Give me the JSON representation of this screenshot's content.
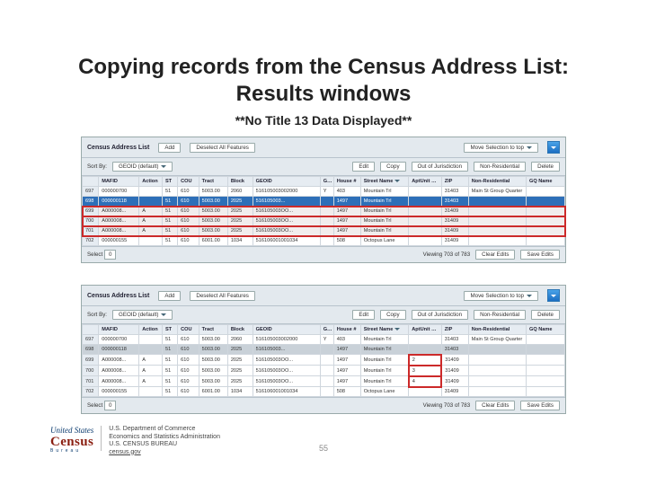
{
  "title": "Copying records from the Census Address List: Results windows",
  "subtitle": "**No Title 13 Data Displayed**",
  "page_number": "55",
  "panel": {
    "header_title": "Census Address List",
    "add": "Add",
    "deselect": "Deselect All Features",
    "move_top": "Move Selection to top",
    "sort_by_label": "Sort By:",
    "sort_by_value": "GEOID (default)",
    "edit": "Edit",
    "copy": "Copy",
    "out_of_jur": "Out of Jurisdiction",
    "non_res": "Non-Residential",
    "delete": "Delete",
    "select_label": "Select",
    "select_count": "0",
    "viewing": "Viewing 703 of 783",
    "clear_edits": "Clear Edits",
    "save_edits": "Save Edits"
  },
  "columns": [
    "MAFID",
    "Action",
    "ST",
    "COU",
    "Tract",
    "Block",
    "GEOID",
    "GQ",
    "House #",
    "Street Name",
    "AptUnit #",
    "ZIP",
    "Non-Residential",
    "GQ Name"
  ],
  "panel1_rows": [
    {
      "idx": "697",
      "mafid": "000000700",
      "act": "",
      "st": "51",
      "cou": "610",
      "tract": "5003.00",
      "block": "2060",
      "geoid": "516105003002000",
      "gq": "Y",
      "house": "403",
      "street": "Mountain Trl",
      "apt": "",
      "zip": "31403",
      "nonres": "Main St Group Quarter",
      "gqname": "",
      "cls": "row-norm"
    },
    {
      "idx": "698",
      "mafid": "000000118",
      "act": "",
      "st": "51",
      "cou": "610",
      "tract": "5003.00",
      "block": "2025",
      "geoid": "516105003...",
      "gq": "",
      "house": "1497",
      "street": "Mountain Trl",
      "apt": "",
      "zip": "31403",
      "nonres": "",
      "gqname": "",
      "cls": "sel-blue"
    },
    {
      "idx": "699",
      "mafid": "A000008...",
      "act": "A",
      "st": "51",
      "cou": "610",
      "tract": "5003.00",
      "block": "2025",
      "geoid": "516105003OO...",
      "gq": "",
      "house": "1497",
      "street": "Mountain Trl",
      "apt": "",
      "zip": "31409",
      "nonres": "",
      "gqname": "",
      "cls": "hl-red"
    },
    {
      "idx": "700",
      "mafid": "A000008...",
      "act": "A",
      "st": "51",
      "cou": "610",
      "tract": "5003.00",
      "block": "2025",
      "geoid": "516105003OO...",
      "gq": "",
      "house": "1497",
      "street": "Mountain Trl",
      "apt": "",
      "zip": "31409",
      "nonres": "",
      "gqname": "",
      "cls": "hl-red"
    },
    {
      "idx": "701",
      "mafid": "A000008...",
      "act": "A",
      "st": "51",
      "cou": "610",
      "tract": "5003.00",
      "block": "2025",
      "geoid": "516105003OO...",
      "gq": "",
      "house": "1497",
      "street": "Mountain Trl",
      "apt": "",
      "zip": "31409",
      "nonres": "",
      "gqname": "",
      "cls": "hl-red"
    },
    {
      "idx": "702",
      "mafid": "000000155",
      "act": "",
      "st": "51",
      "cou": "610",
      "tract": "6001.00",
      "block": "1034",
      "geoid": "516106001001034",
      "gq": "",
      "house": "508",
      "street": "Octopus Lane",
      "apt": "",
      "zip": "31409",
      "nonres": "",
      "gqname": "",
      "cls": "row-norm"
    }
  ],
  "panel2_rows": [
    {
      "idx": "697",
      "mafid": "000000700",
      "act": "",
      "st": "51",
      "cou": "610",
      "tract": "5003.00",
      "block": "2060",
      "geoid": "516105003002000",
      "gq": "Y",
      "house": "403",
      "street": "Mountain Trl",
      "apt": "",
      "zip": "31403",
      "nonres": "Main St Group Quarter",
      "gqname": "",
      "cls": "row-norm",
      "aptcls": ""
    },
    {
      "idx": "698",
      "mafid": "000000118",
      "act": "",
      "st": "51",
      "cou": "610",
      "tract": "5003.00",
      "block": "2025",
      "geoid": "516105003...",
      "gq": "",
      "house": "1497",
      "street": "Mountain Trl",
      "apt": "",
      "zip": "31403",
      "nonres": "",
      "gqname": "",
      "cls": "sel-grey",
      "aptcls": ""
    },
    {
      "idx": "699",
      "mafid": "A000008...",
      "act": "A",
      "st": "51",
      "cou": "610",
      "tract": "5003.00",
      "block": "2025",
      "geoid": "516105003OO...",
      "gq": "",
      "house": "1497",
      "street": "Mountain Trl",
      "apt": "2",
      "zip": "31409",
      "nonres": "",
      "gqname": "",
      "cls": "row-norm",
      "aptcls": "red-cell"
    },
    {
      "idx": "700",
      "mafid": "A000008...",
      "act": "A",
      "st": "51",
      "cou": "610",
      "tract": "5003.00",
      "block": "2025",
      "geoid": "516105003OO...",
      "gq": "",
      "house": "1497",
      "street": "Mountain Trl",
      "apt": "3",
      "zip": "31409",
      "nonres": "",
      "gqname": "",
      "cls": "row-norm",
      "aptcls": "red-cell"
    },
    {
      "idx": "701",
      "mafid": "A000008...",
      "act": "A",
      "st": "51",
      "cou": "610",
      "tract": "5003.00",
      "block": "2025",
      "geoid": "516105003OO...",
      "gq": "",
      "house": "1497",
      "street": "Mountain Trl",
      "apt": "4",
      "zip": "31409",
      "nonres": "",
      "gqname": "",
      "cls": "row-norm",
      "aptcls": "red-cell"
    },
    {
      "idx": "702",
      "mafid": "000000155",
      "act": "",
      "st": "51",
      "cou": "610",
      "tract": "6001.00",
      "block": "1034",
      "geoid": "516106001001034",
      "gq": "",
      "house": "508",
      "street": "Octopus Lane",
      "apt": "",
      "zip": "31409",
      "nonres": "",
      "gqname": "",
      "cls": "row-norm",
      "aptcls": ""
    }
  ],
  "footer": {
    "us": "United States",
    "census": "Census",
    "bureau": "Bureau",
    "dept1": "U.S. Department of Commerce",
    "dept2": "Economics and Statistics Administration",
    "dept3": "U.S. CENSUS BUREAU",
    "dept4": "census.gov"
  }
}
